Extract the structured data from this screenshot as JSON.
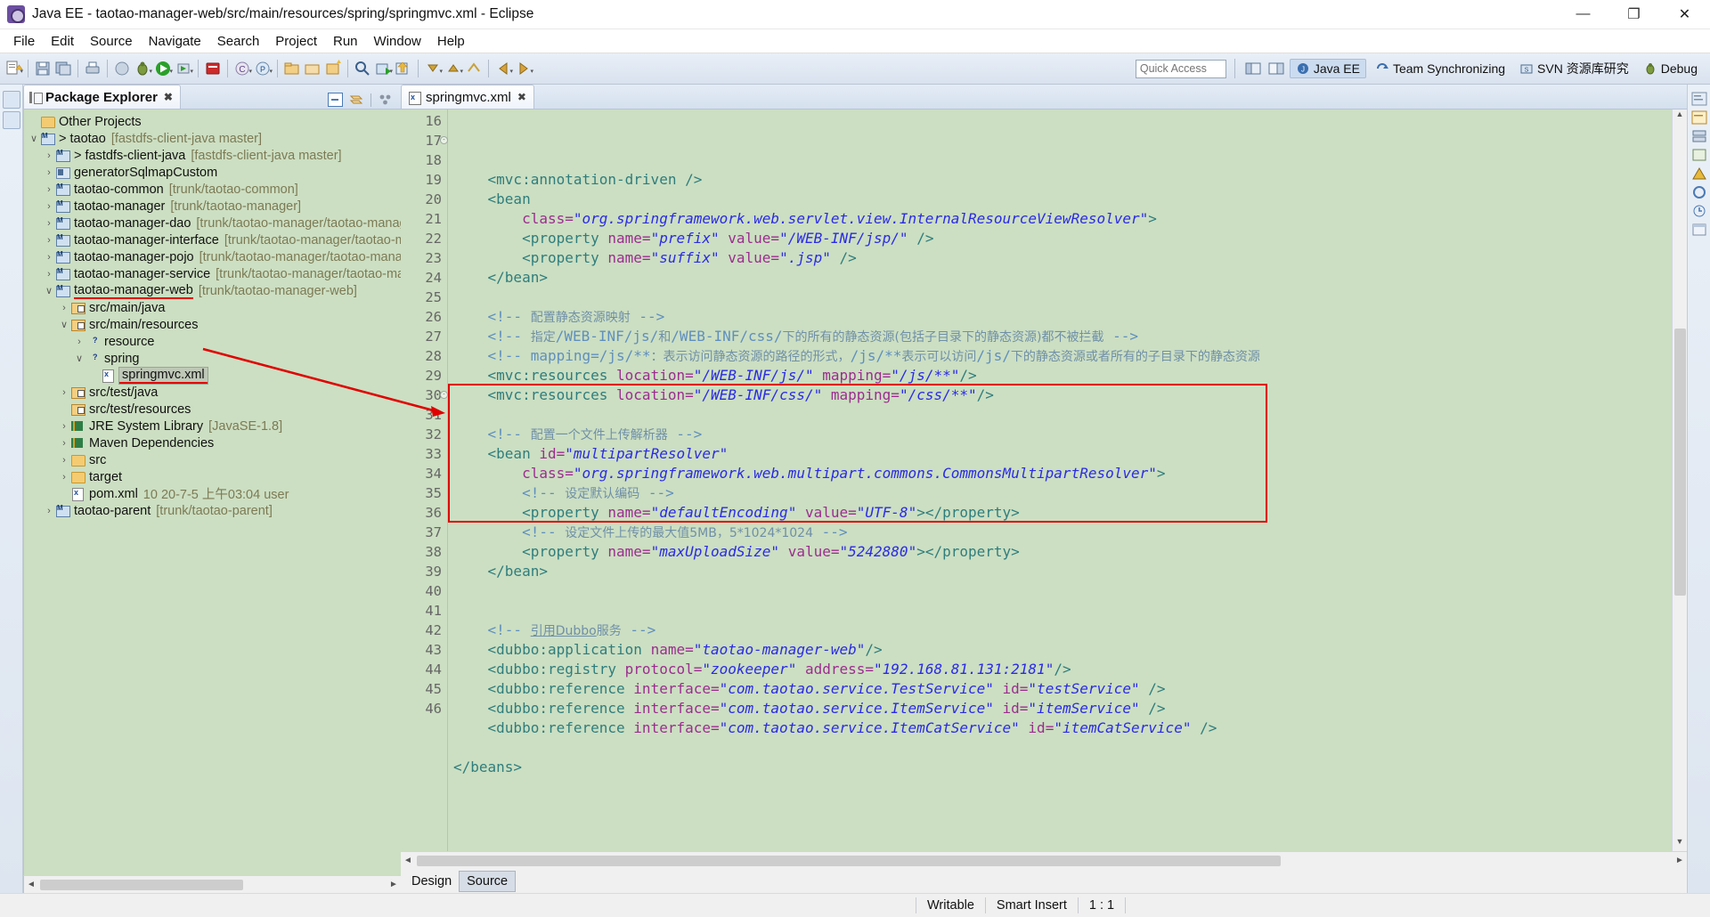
{
  "window": {
    "title": "Java EE - taotao-manager-web/src/main/resources/spring/springmvc.xml - Eclipse",
    "minimize": "—",
    "maximize": "❐",
    "close": "✕"
  },
  "menubar": {
    "items": [
      "File",
      "Edit",
      "Source",
      "Navigate",
      "Search",
      "Project",
      "Run",
      "Window",
      "Help"
    ]
  },
  "toolbar": {
    "quick_access_placeholder": "Quick Access",
    "perspectives": [
      {
        "label": "Java EE",
        "active": true
      },
      {
        "label": "Team Synchronizing",
        "active": false
      },
      {
        "label": "SVN 资源库研究",
        "active": false
      },
      {
        "label": "Debug",
        "active": false
      }
    ]
  },
  "package_explorer": {
    "title": "Package Explorer",
    "close_glyph": "✖",
    "tree": [
      {
        "indent": 0,
        "twisty": "",
        "icon": "folder",
        "label": "Other Projects",
        "loc": ""
      },
      {
        "indent": 0,
        "twisty": "∨",
        "icon": "mvn",
        "label": "> taotao",
        "loc": "[fastdfs-client-java master]"
      },
      {
        "indent": 1,
        "twisty": "›",
        "icon": "mvn",
        "label": "> fastdfs-client-java",
        "loc": "[fastdfs-client-java master]"
      },
      {
        "indent": 1,
        "twisty": "›",
        "icon": "prj",
        "label": "generatorSqlmapCustom",
        "loc": ""
      },
      {
        "indent": 1,
        "twisty": "›",
        "icon": "mvn",
        "label": "taotao-common",
        "loc": "[trunk/taotao-common]"
      },
      {
        "indent": 1,
        "twisty": "›",
        "icon": "mvn",
        "label": "taotao-manager",
        "loc": "[trunk/taotao-manager]"
      },
      {
        "indent": 1,
        "twisty": "›",
        "icon": "mvn",
        "label": "taotao-manager-dao",
        "loc": "[trunk/taotao-manager/taotao-manager-…"
      },
      {
        "indent": 1,
        "twisty": "›",
        "icon": "mvn",
        "label": "taotao-manager-interface",
        "loc": "[trunk/taotao-manager/taotao-mana…"
      },
      {
        "indent": 1,
        "twisty": "›",
        "icon": "mvn",
        "label": "taotao-manager-pojo",
        "loc": "[trunk/taotao-manager/taotao-manager…"
      },
      {
        "indent": 1,
        "twisty": "›",
        "icon": "mvn",
        "label": "taotao-manager-service",
        "loc": "[trunk/taotao-manager/taotao-manag…"
      },
      {
        "indent": 1,
        "twisty": "∨",
        "icon": "mvn",
        "label": "taotao-manager-web",
        "loc": "[trunk/taotao-manager-web]",
        "underline": true
      },
      {
        "indent": 2,
        "twisty": "›",
        "icon": "src",
        "label": "src/main/java",
        "loc": ""
      },
      {
        "indent": 2,
        "twisty": "∨",
        "icon": "src",
        "label": "src/main/resources",
        "loc": ""
      },
      {
        "indent": 3,
        "twisty": "›",
        "icon": "folderq",
        "label": "resource",
        "loc": ""
      },
      {
        "indent": 3,
        "twisty": "∨",
        "icon": "folderq",
        "label": "spring",
        "loc": ""
      },
      {
        "indent": 4,
        "twisty": "",
        "icon": "xml",
        "label": "springmvc.xml",
        "loc": "",
        "selected": true,
        "underline": true
      },
      {
        "indent": 2,
        "twisty": "›",
        "icon": "src",
        "label": "src/test/java",
        "loc": ""
      },
      {
        "indent": 2,
        "twisty": "",
        "icon": "src",
        "label": "src/test/resources",
        "loc": ""
      },
      {
        "indent": 2,
        "twisty": "›",
        "icon": "lib",
        "label": "JRE System Library",
        "loc": "[JavaSE-1.8]"
      },
      {
        "indent": 2,
        "twisty": "›",
        "icon": "lib",
        "label": "Maven Dependencies",
        "loc": ""
      },
      {
        "indent": 2,
        "twisty": "›",
        "icon": "folder",
        "label": "src",
        "loc": ""
      },
      {
        "indent": 2,
        "twisty": "›",
        "icon": "folder",
        "label": "target",
        "loc": ""
      },
      {
        "indent": 2,
        "twisty": "",
        "icon": "xml",
        "label": "pom.xml",
        "loc": "10  20-7-5 上午03:04  user"
      },
      {
        "indent": 1,
        "twisty": "›",
        "icon": "mvn",
        "label": "taotao-parent",
        "loc": "[trunk/taotao-parent]"
      }
    ]
  },
  "editor": {
    "tab_label": "springmvc.xml",
    "tab_close_glyph": "✖",
    "bottom_tabs": [
      {
        "label": "Design",
        "active": false
      },
      {
        "label": "Source",
        "active": true
      }
    ],
    "first_line_number": 16,
    "lines": [
      {
        "n": 16,
        "fold": false,
        "tokens": [
          {
            "t": "plain",
            "v": "    "
          },
          {
            "t": "tag",
            "v": "<mvc:annotation-driven />"
          }
        ]
      },
      {
        "n": 17,
        "fold": true,
        "tokens": [
          {
            "t": "plain",
            "v": "    "
          },
          {
            "t": "tag",
            "v": "<bean"
          }
        ]
      },
      {
        "n": 18,
        "fold": false,
        "tokens": [
          {
            "t": "plain",
            "v": "        "
          },
          {
            "t": "attr",
            "v": "class="
          },
          {
            "t": "val",
            "v": "\"org.springframework.web.servlet.view.InternalResourceViewResolver\""
          },
          {
            "t": "tag",
            "v": ">"
          }
        ]
      },
      {
        "n": 19,
        "fold": false,
        "tokens": [
          {
            "t": "plain",
            "v": "        "
          },
          {
            "t": "tag",
            "v": "<property "
          },
          {
            "t": "attr",
            "v": "name="
          },
          {
            "t": "val",
            "v": "\"prefix\""
          },
          {
            "t": "plain",
            "v": " "
          },
          {
            "t": "attr",
            "v": "value="
          },
          {
            "t": "val",
            "v": "\"/WEB-INF/jsp/\""
          },
          {
            "t": "tag",
            "v": " />"
          }
        ]
      },
      {
        "n": 20,
        "fold": false,
        "tokens": [
          {
            "t": "plain",
            "v": "        "
          },
          {
            "t": "tag",
            "v": "<property "
          },
          {
            "t": "attr",
            "v": "name="
          },
          {
            "t": "val",
            "v": "\"suffix\""
          },
          {
            "t": "plain",
            "v": " "
          },
          {
            "t": "attr",
            "v": "value="
          },
          {
            "t": "val",
            "v": "\".jsp\""
          },
          {
            "t": "tag",
            "v": " />"
          }
        ]
      },
      {
        "n": 21,
        "fold": false,
        "tokens": [
          {
            "t": "plain",
            "v": "    "
          },
          {
            "t": "tag",
            "v": "</bean>"
          }
        ]
      },
      {
        "n": 22,
        "fold": false,
        "tokens": []
      },
      {
        "n": 23,
        "fold": false,
        "tokens": [
          {
            "t": "plain",
            "v": "    "
          },
          {
            "t": "cmt",
            "v": "<!-- "
          },
          {
            "t": "cmtcn",
            "v": "配置静态资源映射"
          },
          {
            "t": "cmt",
            "v": " -->"
          }
        ]
      },
      {
        "n": 24,
        "fold": false,
        "tokens": [
          {
            "t": "plain",
            "v": "    "
          },
          {
            "t": "cmt",
            "v": "<!-- "
          },
          {
            "t": "cmtcn",
            "v": "指定"
          },
          {
            "t": "cmt",
            "v": "/WEB-INF/js/"
          },
          {
            "t": "cmtcn",
            "v": "和"
          },
          {
            "t": "cmt",
            "v": "/WEB-INF/css/"
          },
          {
            "t": "cmtcn",
            "v": "下的所有的静态资源(包括子目录下的静态资源)都不被拦截"
          },
          {
            "t": "cmt",
            "v": " -->"
          }
        ]
      },
      {
        "n": 25,
        "fold": false,
        "tokens": [
          {
            "t": "plain",
            "v": "    "
          },
          {
            "t": "cmt",
            "v": "<!-- mapping=/js/**"
          },
          {
            "t": "cmtcn",
            "v": "：表示访问静态资源的路径的形式，"
          },
          {
            "t": "cmt",
            "v": "/js/**"
          },
          {
            "t": "cmtcn",
            "v": "表示可以访问"
          },
          {
            "t": "cmt",
            "v": "/js/"
          },
          {
            "t": "cmtcn",
            "v": "下的静态资源或者所有的子目录下的静态资源"
          }
        ]
      },
      {
        "n": 26,
        "fold": false,
        "tokens": [
          {
            "t": "plain",
            "v": "    "
          },
          {
            "t": "tag",
            "v": "<mvc:resources "
          },
          {
            "t": "attr",
            "v": "location="
          },
          {
            "t": "val",
            "v": "\"/WEB-INF/js/\""
          },
          {
            "t": "plain",
            "v": " "
          },
          {
            "t": "attr",
            "v": "mapping="
          },
          {
            "t": "val",
            "v": "\"/js/**\""
          },
          {
            "t": "tag",
            "v": "/>"
          }
        ]
      },
      {
        "n": 27,
        "fold": false,
        "tokens": [
          {
            "t": "plain",
            "v": "    "
          },
          {
            "t": "tag",
            "v": "<mvc:resources "
          },
          {
            "t": "attr",
            "v": "location="
          },
          {
            "t": "val",
            "v": "\"/WEB-INF/css/\""
          },
          {
            "t": "plain",
            "v": " "
          },
          {
            "t": "attr",
            "v": "mapping="
          },
          {
            "t": "val",
            "v": "\"/css/**\""
          },
          {
            "t": "tag",
            "v": "/>"
          }
        ]
      },
      {
        "n": 28,
        "fold": false,
        "tokens": []
      },
      {
        "n": 29,
        "fold": false,
        "tokens": [
          {
            "t": "plain",
            "v": "    "
          },
          {
            "t": "cmt",
            "v": "<!-- "
          },
          {
            "t": "cmtcn",
            "v": "配置一个文件上传解析器"
          },
          {
            "t": "cmt",
            "v": " -->"
          }
        ]
      },
      {
        "n": 30,
        "fold": true,
        "tokens": [
          {
            "t": "plain",
            "v": "    "
          },
          {
            "t": "tag",
            "v": "<bean "
          },
          {
            "t": "attr",
            "v": "id="
          },
          {
            "t": "val",
            "v": "\"multipartResolver\""
          }
        ]
      },
      {
        "n": 31,
        "fold": false,
        "tokens": [
          {
            "t": "plain",
            "v": "        "
          },
          {
            "t": "attr",
            "v": "class="
          },
          {
            "t": "val",
            "v": "\"org.springframework.web.multipart.commons.CommonsMultipartResolver\""
          },
          {
            "t": "tag",
            "v": ">"
          }
        ]
      },
      {
        "n": 32,
        "fold": false,
        "tokens": [
          {
            "t": "plain",
            "v": "        "
          },
          {
            "t": "cmt",
            "v": "<!-- "
          },
          {
            "t": "cmtcn",
            "v": "设定默认编码"
          },
          {
            "t": "cmt",
            "v": " -->"
          }
        ]
      },
      {
        "n": 33,
        "fold": false,
        "tokens": [
          {
            "t": "plain",
            "v": "        "
          },
          {
            "t": "tag",
            "v": "<property "
          },
          {
            "t": "attr",
            "v": "name="
          },
          {
            "t": "val",
            "v": "\"defaultEncoding\""
          },
          {
            "t": "plain",
            "v": " "
          },
          {
            "t": "attr",
            "v": "value="
          },
          {
            "t": "val",
            "v": "\"UTF-8\""
          },
          {
            "t": "tag",
            "v": "></property>"
          }
        ]
      },
      {
        "n": 34,
        "fold": false,
        "tokens": [
          {
            "t": "plain",
            "v": "        "
          },
          {
            "t": "cmt",
            "v": "<!-- "
          },
          {
            "t": "cmtcn",
            "v": "设定文件上传的最大值5MB，5*1024*1024"
          },
          {
            "t": "cmt",
            "v": " -->"
          }
        ]
      },
      {
        "n": 35,
        "fold": false,
        "tokens": [
          {
            "t": "plain",
            "v": "        "
          },
          {
            "t": "tag",
            "v": "<property "
          },
          {
            "t": "attr",
            "v": "name="
          },
          {
            "t": "val",
            "v": "\"maxUploadSize\""
          },
          {
            "t": "plain",
            "v": " "
          },
          {
            "t": "attr",
            "v": "value="
          },
          {
            "t": "val",
            "v": "\"5242880\""
          },
          {
            "t": "tag",
            "v": "></property>"
          }
        ]
      },
      {
        "n": 36,
        "fold": false,
        "tokens": [
          {
            "t": "plain",
            "v": "    "
          },
          {
            "t": "tag",
            "v": "</bean>"
          }
        ]
      },
      {
        "n": 37,
        "fold": false,
        "tokens": []
      },
      {
        "n": 38,
        "fold": false,
        "tokens": []
      },
      {
        "n": 39,
        "fold": false,
        "tokens": [
          {
            "t": "plain",
            "v": "    "
          },
          {
            "t": "cmt",
            "v": "<!-- "
          },
          {
            "t": "cmtcn-u",
            "v": "引用Dubbo"
          },
          {
            "t": "cmtcn",
            "v": "服务"
          },
          {
            "t": "cmt",
            "v": " -->"
          }
        ]
      },
      {
        "n": 40,
        "fold": false,
        "tokens": [
          {
            "t": "plain",
            "v": "    "
          },
          {
            "t": "tag",
            "v": "<dubbo:application "
          },
          {
            "t": "attr",
            "v": "name="
          },
          {
            "t": "val",
            "v": "\"taotao-manager-web\""
          },
          {
            "t": "tag",
            "v": "/>"
          }
        ]
      },
      {
        "n": 41,
        "fold": false,
        "tokens": [
          {
            "t": "plain",
            "v": "    "
          },
          {
            "t": "tag",
            "v": "<dubbo:registry "
          },
          {
            "t": "attr",
            "v": "protocol="
          },
          {
            "t": "val",
            "v": "\"zookeeper\""
          },
          {
            "t": "plain",
            "v": " "
          },
          {
            "t": "attr",
            "v": "address="
          },
          {
            "t": "val",
            "v": "\"192.168.81.131:2181\""
          },
          {
            "t": "tag",
            "v": "/>"
          }
        ]
      },
      {
        "n": 42,
        "fold": false,
        "tokens": [
          {
            "t": "plain",
            "v": "    "
          },
          {
            "t": "tag",
            "v": "<dubbo:reference "
          },
          {
            "t": "attr",
            "v": "interface="
          },
          {
            "t": "val",
            "v": "\"com.taotao.service.TestService\""
          },
          {
            "t": "plain",
            "v": " "
          },
          {
            "t": "attr",
            "v": "id="
          },
          {
            "t": "val",
            "v": "\"testService\""
          },
          {
            "t": "tag",
            "v": " />"
          }
        ]
      },
      {
        "n": 43,
        "fold": false,
        "tokens": [
          {
            "t": "plain",
            "v": "    "
          },
          {
            "t": "tag",
            "v": "<dubbo:reference "
          },
          {
            "t": "attr",
            "v": "interface="
          },
          {
            "t": "val",
            "v": "\"com.taotao.service.ItemService\""
          },
          {
            "t": "plain",
            "v": " "
          },
          {
            "t": "attr",
            "v": "id="
          },
          {
            "t": "val",
            "v": "\"itemService\""
          },
          {
            "t": "tag",
            "v": " />"
          }
        ]
      },
      {
        "n": 44,
        "fold": false,
        "tokens": [
          {
            "t": "plain",
            "v": "    "
          },
          {
            "t": "tag",
            "v": "<dubbo:reference "
          },
          {
            "t": "attr",
            "v": "interface="
          },
          {
            "t": "val",
            "v": "\"com.taotao.service.ItemCatService\""
          },
          {
            "t": "plain",
            "v": " "
          },
          {
            "t": "attr",
            "v": "id="
          },
          {
            "t": "val",
            "v": "\"itemCatService\""
          },
          {
            "t": "tag",
            "v": " />"
          }
        ]
      },
      {
        "n": 45,
        "fold": false,
        "tokens": []
      },
      {
        "n": 46,
        "fold": false,
        "tokens": [
          {
            "t": "tag",
            "v": "</beans>"
          }
        ]
      }
    ],
    "annotation": {
      "box_color": "#e00000",
      "arrow_color": "#e00000",
      "box_start_line": 30,
      "box_end_line": 36
    }
  },
  "statusbar": {
    "writable": "Writable",
    "insert_mode": "Smart Insert",
    "position": "1 : 1"
  }
}
